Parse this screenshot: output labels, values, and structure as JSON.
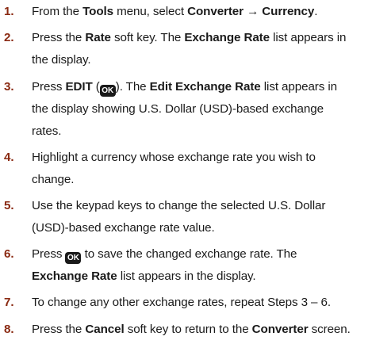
{
  "steps": [
    {
      "number": "1.",
      "line1": {
        "t1": "From the ",
        "b1": "Tools",
        "t2": " menu, select ",
        "b2": "Converter → Currency",
        "t3": "."
      }
    },
    {
      "number": "2.",
      "line1": {
        "t1": "Press the ",
        "b1": "Rate",
        "t2": " soft key. The ",
        "b2": "Exchange Rate",
        "t3": " list appears in"
      },
      "line2": "the display."
    },
    {
      "number": "3.",
      "line1": {
        "t1": "Press ",
        "b1": "EDIT",
        "t2": " (",
        "t3": "). The ",
        "b2": "Edit Exchange Rate",
        "t4": " list appears in"
      },
      "line2": "the display showing U.S. Dollar (USD)-based exchange",
      "line3": "rates."
    },
    {
      "number": "4.",
      "line1": "Highlight a currency whose exchange rate you wish to",
      "line2": "change."
    },
    {
      "number": "5.",
      "line1": "Use the keypad keys to change the selected U.S. Dollar",
      "line2": "(USD)-based exchange rate value."
    },
    {
      "number": "6.",
      "line1": {
        "t1": "Press ",
        "t2": " to save the changed exchange rate. The"
      },
      "line2": {
        "b1": "Exchange Rate",
        "t1": " list appears in the display."
      }
    },
    {
      "number": "7.",
      "line1": "To change any other exchange rates, repeat Steps 3 – 6."
    },
    {
      "number": "8.",
      "line1": {
        "t1": "Press the ",
        "b1": "Cancel",
        "t2": " soft key to return to the ",
        "b2": "Converter",
        "t3": " screen."
      }
    }
  ],
  "ok_key": {
    "label": "OK",
    "icon": "ok-key-icon"
  }
}
